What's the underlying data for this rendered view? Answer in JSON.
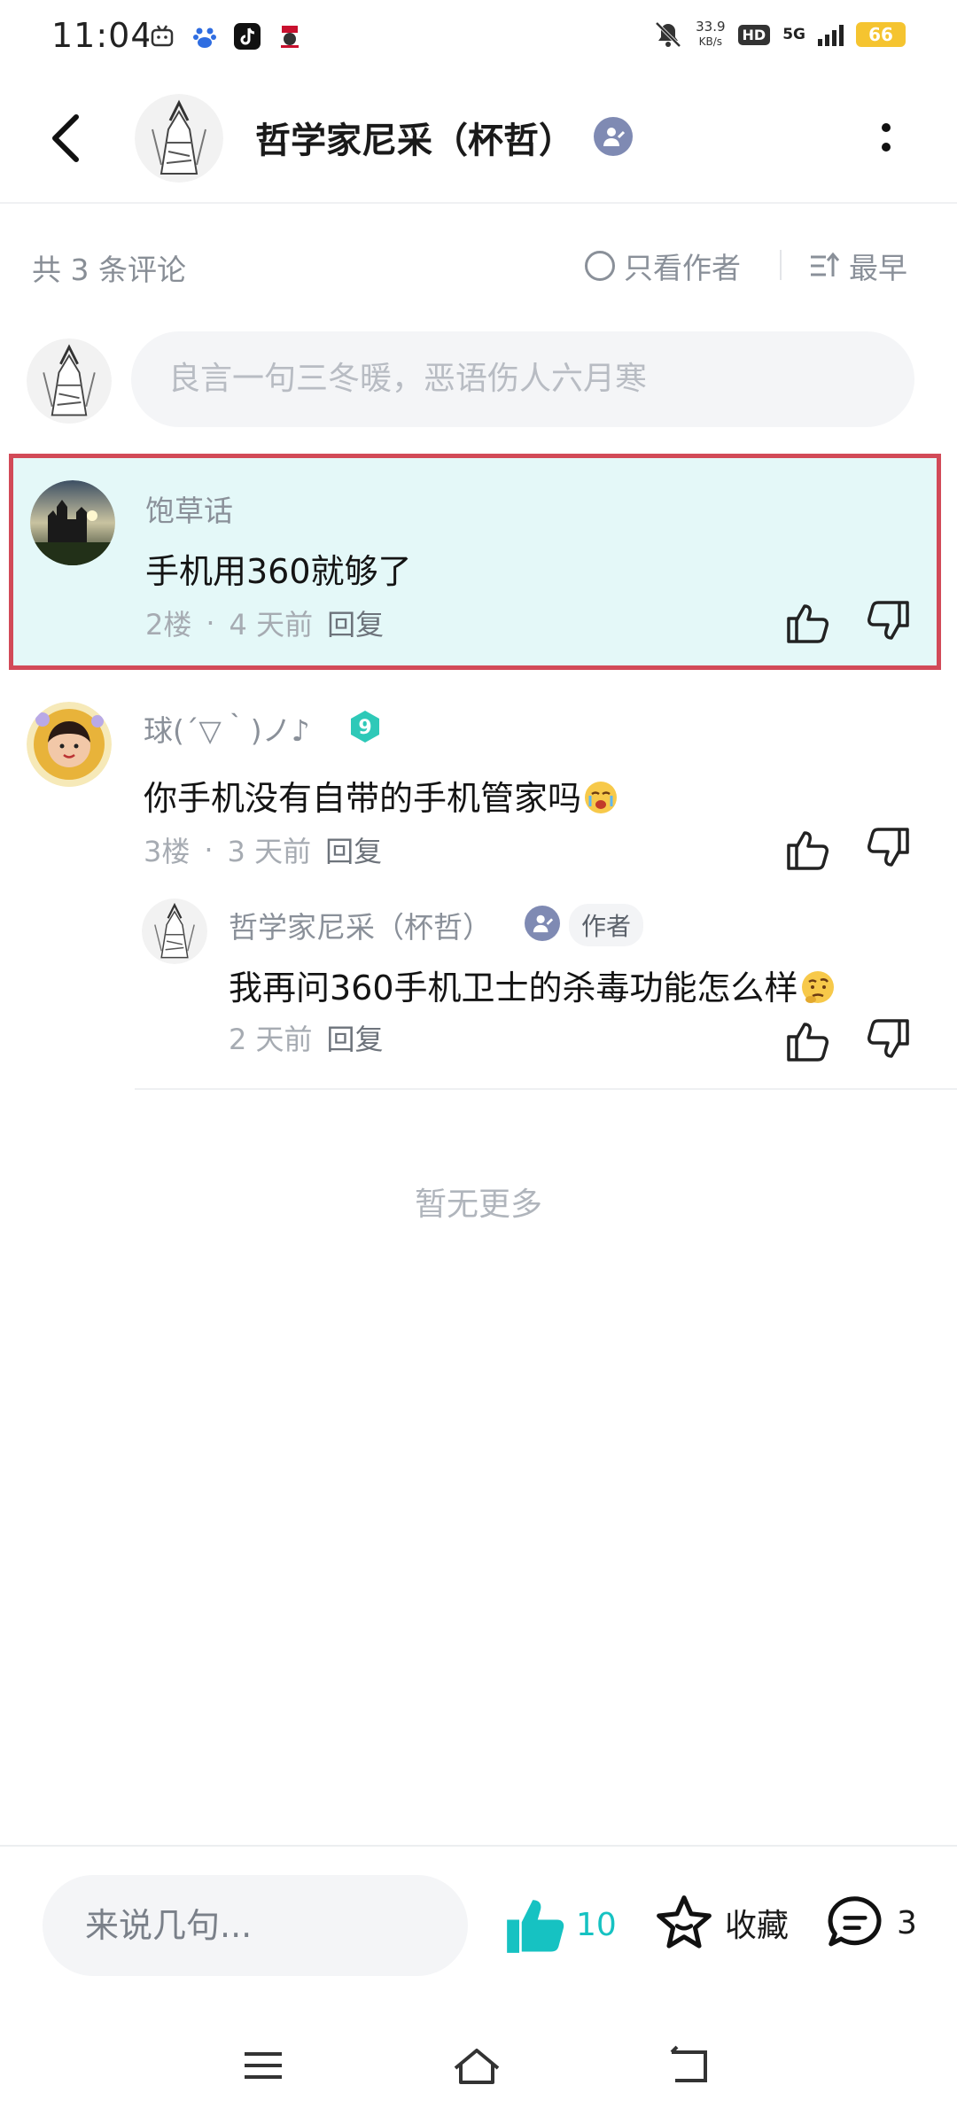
{
  "status_bar": {
    "time": "11:04",
    "net_speed": "33.9",
    "net_unit": "KB/s",
    "hd": "HD",
    "network": "5G",
    "battery": "66"
  },
  "header": {
    "title": "哲学家尼采（杯哲）"
  },
  "sub_bar": {
    "count_label": "共 3 条评论",
    "author_only": "只看作者",
    "sort": "最早"
  },
  "comment_input": {
    "placeholder": "良言一句三冬暖，恶语伤人六月寒"
  },
  "comments": [
    {
      "name": "饱草话",
      "text": "手机用360就够了",
      "floor": "2楼",
      "dot": "·",
      "time": "4 天前",
      "reply": "回复"
    },
    {
      "name": "球(´▽｀)ノ♪",
      "level": "9",
      "text": "你手机没有自带的手机管家吗",
      "floor": "3楼",
      "dot": "·",
      "time": "3 天前",
      "reply": "回复",
      "sub_reply": {
        "name": "哲学家尼采（杯哲）",
        "tag": "作者",
        "text": "我再问360手机卫士的杀毒功能怎么样",
        "time": "2 天前",
        "reply": "回复"
      }
    }
  ],
  "no_more": "暂无更多",
  "bottom_bar": {
    "input_placeholder": "来说几句...",
    "like_count": "10",
    "favorite": "收藏",
    "comment_count": "3"
  },
  "colors": {
    "accent": "#16c2c2",
    "highlight_bg": "#e4f8f8",
    "highlight_border": "#d24a58",
    "verified": "#7f8ab3",
    "level_badge": "#2ec9b8"
  }
}
